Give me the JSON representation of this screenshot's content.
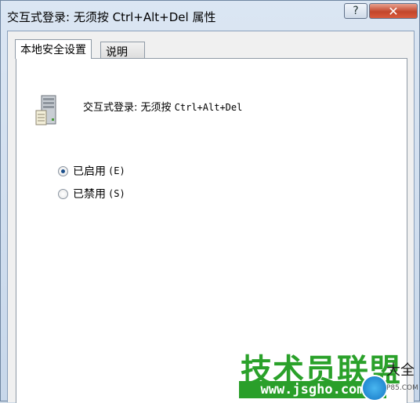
{
  "window": {
    "title": "交互式登录: 无须按 Ctrl+Alt+Del 属性",
    "help_glyph": "?",
    "close_glyph": "✕"
  },
  "tabs": [
    {
      "label": "本地安全设置",
      "active": true
    },
    {
      "label": "说明",
      "active": false
    }
  ],
  "policy": {
    "icon": "server-icon",
    "name_prefix": "交互式登录: 无须按 ",
    "name_key": "Ctrl+Alt+Del"
  },
  "options": [
    {
      "label": "已启用",
      "hotkey": "(E)",
      "checked": true
    },
    {
      "label": "已禁用",
      "hotkey": "(S)",
      "checked": false
    }
  ],
  "watermark": {
    "title": "技术员联盟",
    "url": "www.jsgho.com",
    "suffix": "大全",
    "small": "P85.COM"
  },
  "colors": {
    "accent": "#1b4f8a",
    "close": "#c3462b",
    "watermark_green": "#2aa12a"
  }
}
